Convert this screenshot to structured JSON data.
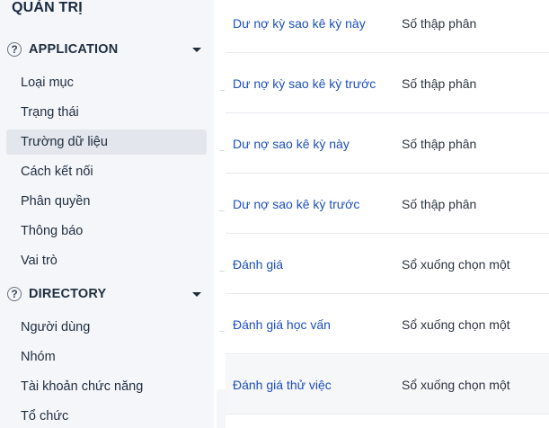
{
  "sidebar": {
    "title": "QUẢN TRỊ",
    "sections": [
      {
        "label": "APPLICATION",
        "help_icon": "?",
        "items": [
          {
            "label": "Loại mục"
          },
          {
            "label": "Trạng thái"
          },
          {
            "label": "Trường dữ liệu",
            "active": true
          },
          {
            "label": "Cách kết nối"
          },
          {
            "label": "Phân quyền"
          },
          {
            "label": "Thông báo"
          },
          {
            "label": "Vai trò"
          }
        ]
      },
      {
        "label": "DIRECTORY",
        "help_icon": "?",
        "items": [
          {
            "label": "Người dùng"
          },
          {
            "label": "Nhóm"
          },
          {
            "label": "Tài khoản chức năng"
          },
          {
            "label": "Tổ chức"
          }
        ]
      }
    ]
  },
  "fields": [
    {
      "name": "Dư nợ kỳ sao kê kỳ này",
      "type": "Số thập phân"
    },
    {
      "name": "Dư nợ kỳ sao kê kỳ trước",
      "type": "Số thập phân"
    },
    {
      "name": "Dư nợ sao kê kỳ này",
      "type": "Số thập phân"
    },
    {
      "name": "Dư nợ sao kê kỳ trước",
      "type": "Số thập phân"
    },
    {
      "name": "Đánh giá",
      "type": "Sổ xuống chọn một"
    },
    {
      "name": "Đánh giá học vấn",
      "type": "Sổ xuống chọn một"
    },
    {
      "name": "Đánh giá thử việc",
      "type": "Sổ xuống chọn một"
    }
  ],
  "colors": {
    "link": "#1d4fbf",
    "sidebar_bg": "#f4f6fa",
    "active_item_bg": "#e3e6ec"
  }
}
